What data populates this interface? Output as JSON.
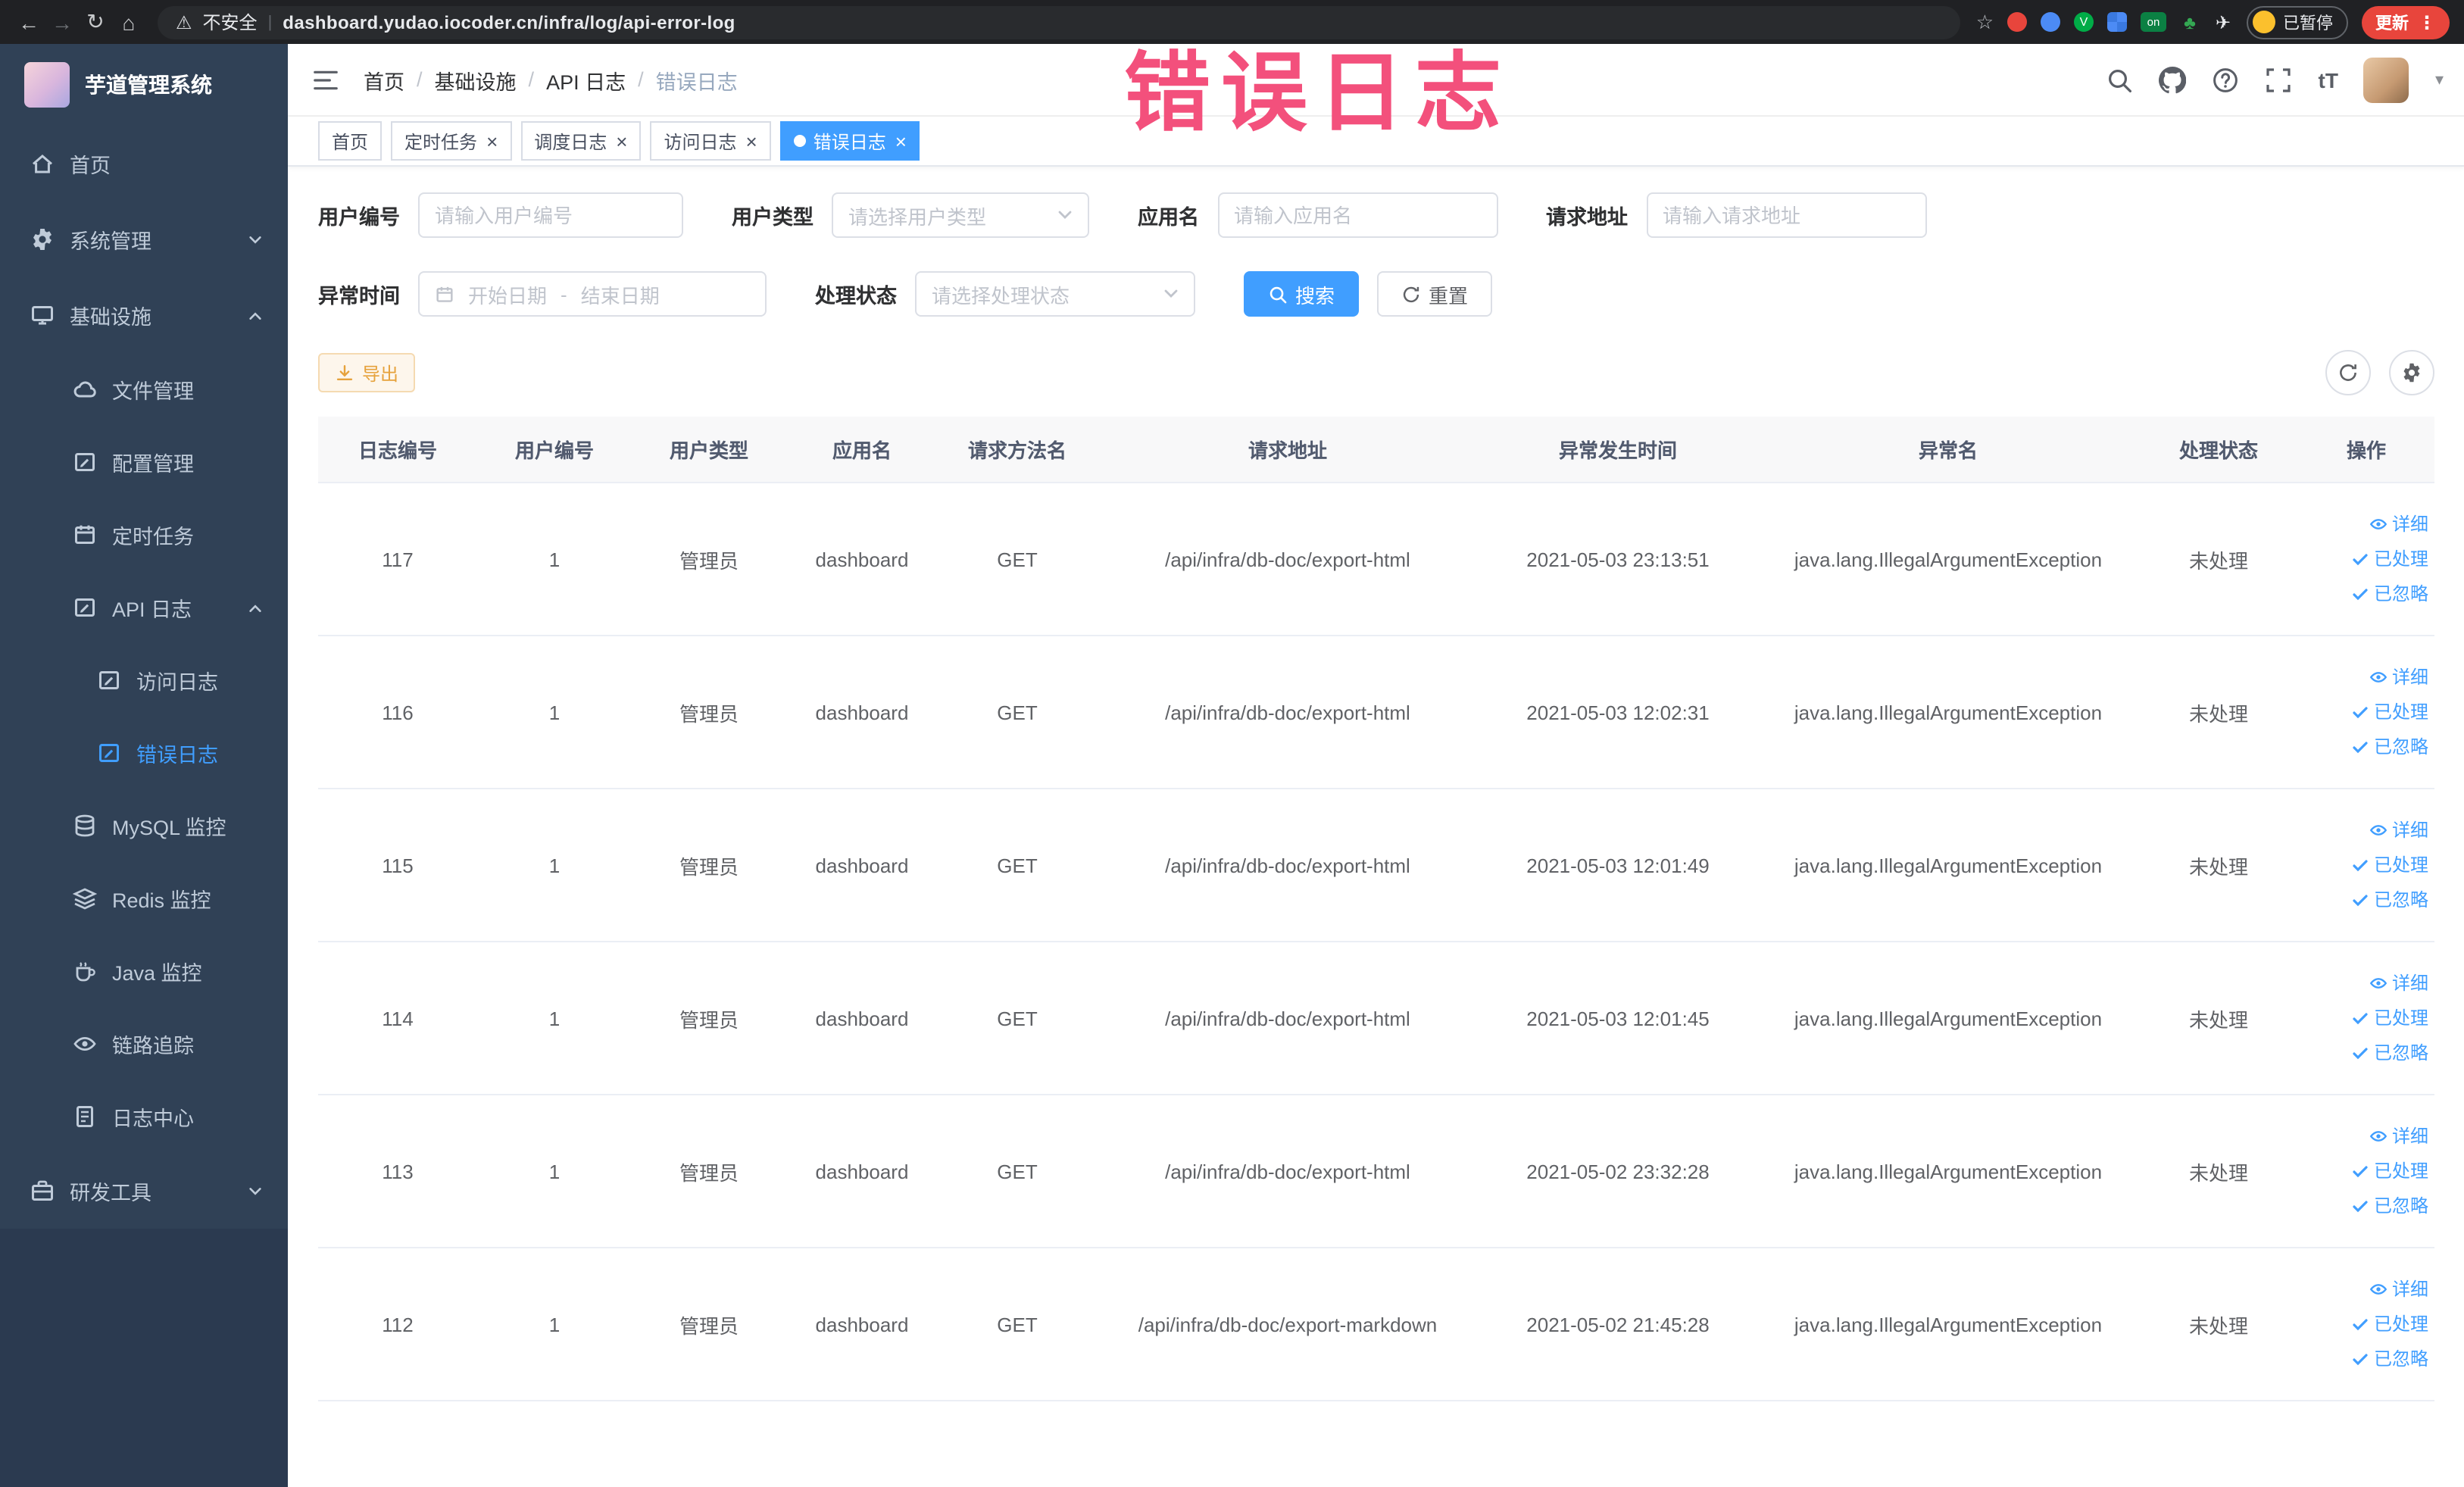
{
  "browser": {
    "security_label": "不安全",
    "url": "dashboard.yudao.iocoder.cn/infra/log/api-error-log",
    "paused_label": "已暂停",
    "update_label": "更新"
  },
  "overlay": {
    "annotation": "错误日志"
  },
  "sidebar": {
    "logo_title": "芋道管理系统",
    "items": [
      {
        "id": "home",
        "label": "首页",
        "icon": "home",
        "level": 1,
        "chevron": null,
        "active": false
      },
      {
        "id": "system",
        "label": "系统管理",
        "icon": "gear",
        "level": 1,
        "chevron": "down",
        "active": false
      },
      {
        "id": "infra",
        "label": "基础设施",
        "icon": "monitor",
        "level": 1,
        "chevron": "up",
        "active": false
      },
      {
        "id": "file",
        "label": "文件管理",
        "icon": "cloud",
        "level": 2,
        "chevron": null,
        "active": false
      },
      {
        "id": "config",
        "label": "配置管理",
        "icon": "edit",
        "level": 2,
        "chevron": null,
        "active": false
      },
      {
        "id": "job",
        "label": "定时任务",
        "icon": "calendar",
        "level": 2,
        "chevron": null,
        "active": false
      },
      {
        "id": "api-log",
        "label": "API 日志",
        "icon": "edit",
        "level": 2,
        "chevron": "up",
        "active": false
      },
      {
        "id": "access-log",
        "label": "访问日志",
        "icon": "edit",
        "level": 3,
        "chevron": null,
        "active": false
      },
      {
        "id": "error-log",
        "label": "错误日志",
        "icon": "edit",
        "level": 3,
        "chevron": null,
        "active": true
      },
      {
        "id": "mysql",
        "label": "MySQL 监控",
        "icon": "db",
        "level": 2,
        "chevron": null,
        "active": false
      },
      {
        "id": "redis",
        "label": "Redis 监控",
        "icon": "layers",
        "level": 2,
        "chevron": null,
        "active": false
      },
      {
        "id": "java",
        "label": "Java 监控",
        "icon": "coffee",
        "level": 2,
        "chevron": null,
        "active": false
      },
      {
        "id": "tracer",
        "label": "链路追踪",
        "icon": "eye",
        "level": 2,
        "chevron": null,
        "active": false
      },
      {
        "id": "log-center",
        "label": "日志中心",
        "icon": "doc",
        "level": 2,
        "chevron": null,
        "active": false
      },
      {
        "id": "dev-tools",
        "label": "研发工具",
        "icon": "briefcase",
        "level": 1,
        "chevron": "down",
        "active": false
      }
    ]
  },
  "header": {
    "breadcrumb": [
      "首页",
      "基础设施",
      "API 日志",
      "错误日志"
    ],
    "tools": [
      "search",
      "github",
      "help",
      "fullscreen",
      "font-size"
    ],
    "font_tool_label": "tT"
  },
  "tabs": [
    {
      "id": "home",
      "label": "首页",
      "closable": false,
      "active": false
    },
    {
      "id": "job",
      "label": "定时任务",
      "closable": true,
      "active": false
    },
    {
      "id": "job-log",
      "label": "调度日志",
      "closable": true,
      "active": false
    },
    {
      "id": "access-log",
      "label": "访问日志",
      "closable": true,
      "active": false
    },
    {
      "id": "error-log",
      "label": "错误日志",
      "closable": true,
      "active": true
    }
  ],
  "filters": {
    "user_id": {
      "label": "用户编号",
      "placeholder": "请输入用户编号"
    },
    "user_type": {
      "label": "用户类型",
      "placeholder": "请选择用户类型"
    },
    "app_name": {
      "label": "应用名",
      "placeholder": "请输入应用名"
    },
    "request_url": {
      "label": "请求地址",
      "placeholder": "请输入请求地址"
    },
    "exception_time": {
      "label": "异常时间",
      "start_placeholder": "开始日期",
      "separator": "-",
      "end_placeholder": "结束日期"
    },
    "process_status": {
      "label": "处理状态",
      "placeholder": "请选择处理状态"
    },
    "search_button": "搜索",
    "reset_button": "重置"
  },
  "toolbar": {
    "export_label": "导出",
    "tools": [
      "refresh-icon",
      "setting-icon"
    ]
  },
  "table": {
    "columns": [
      "日志编号",
      "用户编号",
      "用户类型",
      "应用名",
      "请求方法名",
      "请求地址",
      "异常发生时间",
      "异常名",
      "处理状态",
      "操作"
    ],
    "rows": [
      [
        "117",
        "1",
        "管理员",
        "dashboard",
        "GET",
        "/api/infra/db-doc/export-html",
        "2021-05-03 23:13:51",
        "java.lang.IllegalArgumentException",
        "未处理"
      ],
      [
        "116",
        "1",
        "管理员",
        "dashboard",
        "GET",
        "/api/infra/db-doc/export-html",
        "2021-05-03 12:02:31",
        "java.lang.IllegalArgumentException",
        "未处理"
      ],
      [
        "115",
        "1",
        "管理员",
        "dashboard",
        "GET",
        "/api/infra/db-doc/export-html",
        "2021-05-03 12:01:49",
        "java.lang.IllegalArgumentException",
        "未处理"
      ],
      [
        "114",
        "1",
        "管理员",
        "dashboard",
        "GET",
        "/api/infra/db-doc/export-html",
        "2021-05-03 12:01:45",
        "java.lang.IllegalArgumentException",
        "未处理"
      ],
      [
        "113",
        "1",
        "管理员",
        "dashboard",
        "GET",
        "/api/infra/db-doc/export-html",
        "2021-05-02 23:32:28",
        "java.lang.IllegalArgumentException",
        "未处理"
      ],
      [
        "112",
        "1",
        "管理员",
        "dashboard",
        "GET",
        "/api/infra/db-doc/export-markdown",
        "2021-05-02 21:45:28",
        "java.lang.IllegalArgumentException",
        "未处理"
      ]
    ],
    "actions": [
      {
        "id": "detail",
        "label": "详细",
        "icon": "eye-sm"
      },
      {
        "id": "processed",
        "label": "已处理",
        "icon": "check"
      },
      {
        "id": "ignored",
        "label": "已忽略",
        "icon": "check"
      }
    ]
  },
  "colors": {
    "primary": "#409EFF",
    "warning": "#E6A23C",
    "sidebar_bg": "#304156",
    "annotation_pink": "#F3507C",
    "update_red": "#E8453C"
  }
}
